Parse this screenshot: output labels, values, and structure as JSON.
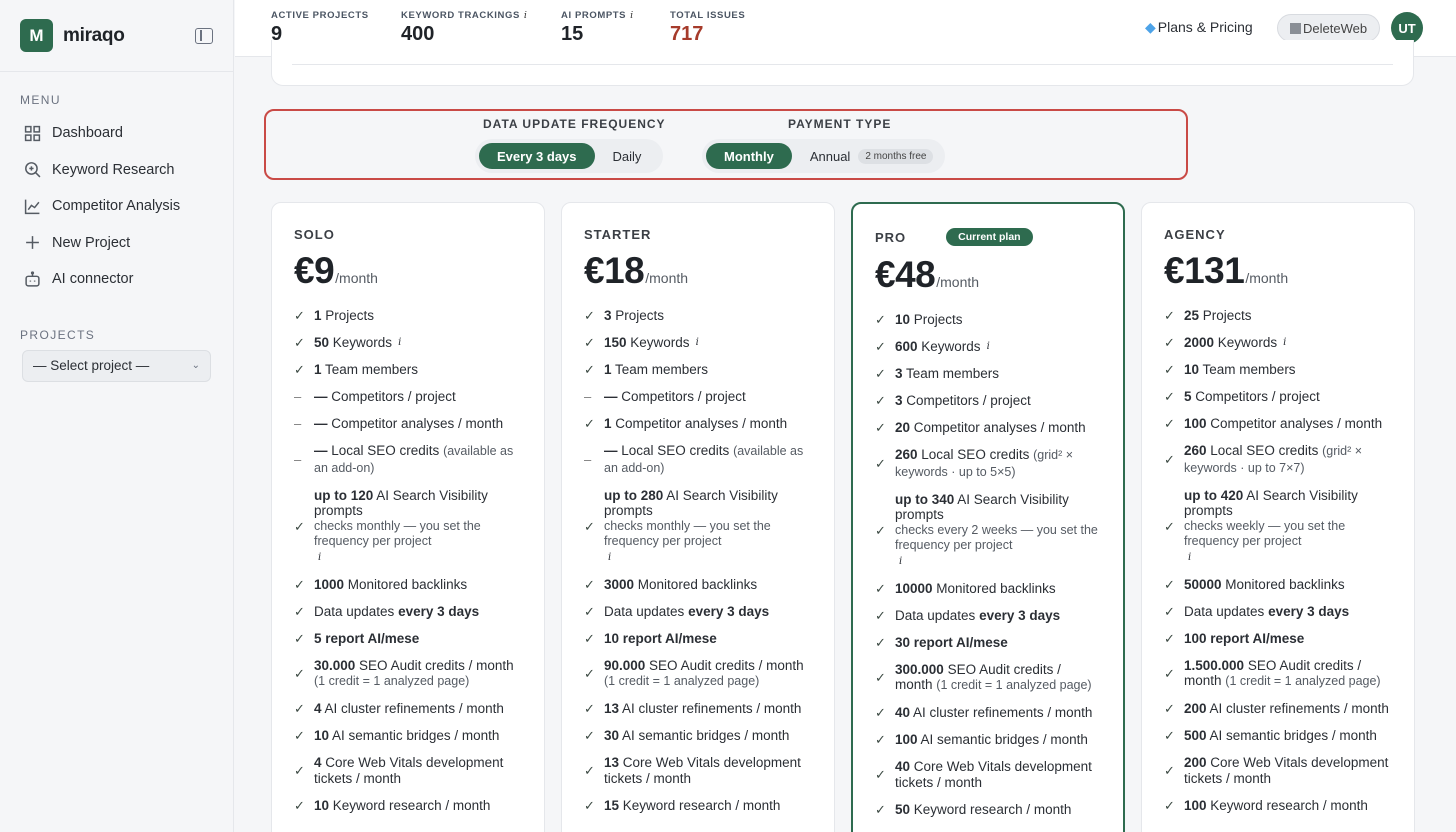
{
  "brand": {
    "name": "miraqo",
    "logo_letter": "M"
  },
  "sidebar": {
    "menu_title": "MENU",
    "items": [
      {
        "label": "Dashboard",
        "icon": "grid-icon"
      },
      {
        "label": "Keyword Research",
        "icon": "search-icon"
      },
      {
        "label": "Competitor Analysis",
        "icon": "line-chart-icon"
      },
      {
        "label": "New Project",
        "icon": "plus-icon"
      },
      {
        "label": "AI connector",
        "icon": "robot-icon"
      }
    ],
    "projects_title": "PROJECTS",
    "project_select": "— Select project —"
  },
  "topbar": {
    "stats": [
      {
        "label": "ACTIVE PROJECTS",
        "value": "9",
        "info": false
      },
      {
        "label": "KEYWORD TRACKINGS",
        "value": "400",
        "info": true
      },
      {
        "label": "AI PROMPTS",
        "value": "15",
        "info": true
      },
      {
        "label": "TOTAL ISSUES",
        "value": "717",
        "info": false
      }
    ],
    "plans_label": "Plans & Pricing",
    "deleteweb_label": "DeleteWeb",
    "avatar": "UT"
  },
  "filters": {
    "frequency_title": "DATA UPDATE FREQUENCY",
    "frequency_options": [
      "Every 3 days",
      "Daily"
    ],
    "frequency_selected": "Every 3 days",
    "payment_title": "PAYMENT TYPE",
    "payment_options": [
      "Monthly",
      "Annual"
    ],
    "payment_selected": "Monthly",
    "annual_badge": "2 months free"
  },
  "plans": [
    {
      "name": "SOLO",
      "price": "€9",
      "per": "/month",
      "current": false,
      "features": [
        {
          "mark": "check",
          "b": "1",
          "t": " Projects"
        },
        {
          "mark": "check",
          "b": "50",
          "t": " Keywords",
          "info": true
        },
        {
          "mark": "check",
          "b": "1",
          "t": " Team members"
        },
        {
          "mark": "dash",
          "b": "—",
          "t": " Competitors / project"
        },
        {
          "mark": "dash",
          "b": "—",
          "t": " Competitor analyses / month"
        },
        {
          "mark": "dash",
          "b": "—",
          "t": " Local SEO credits ",
          "muted": "(available as an add-on)"
        },
        {
          "mark": "check",
          "b": "up to 120",
          "t": " AI Search Visibility prompts",
          "sub": "checks monthly — you set the frequency per project",
          "info_block": true
        },
        {
          "mark": "check",
          "b": "1000",
          "t": " Monitored backlinks"
        },
        {
          "mark": "check",
          "pre": "Data updates ",
          "b": "every 3 days",
          "t": ""
        },
        {
          "mark": "check",
          "b": "5 report AI/mese",
          "t": ""
        },
        {
          "mark": "check",
          "b": "30.000",
          "t": " SEO Audit credits / month ",
          "muted": "(1 credit = 1 analyzed page)"
        },
        {
          "mark": "check",
          "b": "4",
          "t": " AI cluster refinements / month"
        },
        {
          "mark": "check",
          "b": "10",
          "t": " AI semantic bridges / month"
        },
        {
          "mark": "check",
          "b": "4",
          "t": " Core Web Vitals development tickets / month"
        },
        {
          "mark": "check",
          "b": "10",
          "t": " Keyword research / month"
        }
      ]
    },
    {
      "name": "STARTER",
      "price": "€18",
      "per": "/month",
      "current": false,
      "features": [
        {
          "mark": "check",
          "b": "3",
          "t": " Projects"
        },
        {
          "mark": "check",
          "b": "150",
          "t": " Keywords",
          "info": true
        },
        {
          "mark": "check",
          "b": "1",
          "t": " Team members"
        },
        {
          "mark": "dash",
          "b": "—",
          "t": " Competitors / project"
        },
        {
          "mark": "check",
          "b": "1",
          "t": " Competitor analyses / month"
        },
        {
          "mark": "dash",
          "b": "—",
          "t": " Local SEO credits ",
          "muted": "(available as an add-on)"
        },
        {
          "mark": "check",
          "b": "up to 280",
          "t": " AI Search Visibility prompts",
          "sub": "checks monthly — you set the frequency per project",
          "info_block": true
        },
        {
          "mark": "check",
          "b": "3000",
          "t": " Monitored backlinks"
        },
        {
          "mark": "check",
          "pre": "Data updates ",
          "b": "every 3 days",
          "t": ""
        },
        {
          "mark": "check",
          "b": "10 report AI/mese",
          "t": ""
        },
        {
          "mark": "check",
          "b": "90.000",
          "t": " SEO Audit credits / month ",
          "muted": "(1 credit = 1 analyzed page)"
        },
        {
          "mark": "check",
          "b": "13",
          "t": " AI cluster refinements / month"
        },
        {
          "mark": "check",
          "b": "30",
          "t": " AI semantic bridges / month"
        },
        {
          "mark": "check",
          "b": "13",
          "t": " Core Web Vitals development tickets / month"
        },
        {
          "mark": "check",
          "b": "15",
          "t": " Keyword research / month"
        }
      ]
    },
    {
      "name": "PRO",
      "price": "€48",
      "per": "/month",
      "current": true,
      "current_label": "Current plan",
      "features": [
        {
          "mark": "check",
          "b": "10",
          "t": " Projects"
        },
        {
          "mark": "check",
          "b": "600",
          "t": " Keywords",
          "info": true
        },
        {
          "mark": "check",
          "b": "3",
          "t": " Team members"
        },
        {
          "mark": "check",
          "b": "3",
          "t": " Competitors / project"
        },
        {
          "mark": "check",
          "b": "20",
          "t": " Competitor analyses / month"
        },
        {
          "mark": "check",
          "b": "260",
          "t": " Local SEO credits ",
          "muted": "(grid² × keywords · up to 5×5)"
        },
        {
          "mark": "check",
          "b": "up to 340",
          "t": " AI Search Visibility prompts",
          "sub": "checks every 2 weeks — you set the frequency per project",
          "info_block": true
        },
        {
          "mark": "check",
          "b": "10000",
          "t": " Monitored backlinks"
        },
        {
          "mark": "check",
          "pre": "Data updates ",
          "b": "every 3 days",
          "t": ""
        },
        {
          "mark": "check",
          "b": "30 report AI/mese",
          "t": ""
        },
        {
          "mark": "check",
          "b": "300.000",
          "t": " SEO Audit credits / month ",
          "muted": "(1 credit = 1 analyzed page)"
        },
        {
          "mark": "check",
          "b": "40",
          "t": " AI cluster refinements / month"
        },
        {
          "mark": "check",
          "b": "100",
          "t": " AI semantic bridges / month"
        },
        {
          "mark": "check",
          "b": "40",
          "t": " Core Web Vitals development tickets / month"
        },
        {
          "mark": "check",
          "b": "50",
          "t": " Keyword research / month"
        }
      ]
    },
    {
      "name": "AGENCY",
      "price": "€131",
      "per": "/month",
      "current": false,
      "features": [
        {
          "mark": "check",
          "b": "25",
          "t": " Projects"
        },
        {
          "mark": "check",
          "b": "2000",
          "t": " Keywords",
          "info": true
        },
        {
          "mark": "check",
          "b": "10",
          "t": " Team members"
        },
        {
          "mark": "check",
          "b": "5",
          "t": " Competitors / project"
        },
        {
          "mark": "check",
          "b": "100",
          "t": " Competitor analyses / month"
        },
        {
          "mark": "check",
          "b": "260",
          "t": " Local SEO credits ",
          "muted": "(grid² × keywords · up to 7×7)"
        },
        {
          "mark": "check",
          "b": "up to 420",
          "t": " AI Search Visibility prompts",
          "sub": "checks weekly — you set the frequency per project",
          "info_block": true
        },
        {
          "mark": "check",
          "b": "50000",
          "t": " Monitored backlinks"
        },
        {
          "mark": "check",
          "pre": "Data updates ",
          "b": "every 3 days",
          "t": ""
        },
        {
          "mark": "check",
          "b": "100 report AI/mese",
          "t": ""
        },
        {
          "mark": "check",
          "b": "1.500.000",
          "t": " SEO Audit credits / month ",
          "muted": "(1 credit = 1 analyzed page)"
        },
        {
          "mark": "check",
          "b": "200",
          "t": " AI cluster refinements / month"
        },
        {
          "mark": "check",
          "b": "500",
          "t": " AI semantic bridges / month"
        },
        {
          "mark": "check",
          "b": "200",
          "t": " Core Web Vitals development tickets / month"
        },
        {
          "mark": "check",
          "b": "100",
          "t": " Keyword research / month"
        }
      ]
    }
  ]
}
